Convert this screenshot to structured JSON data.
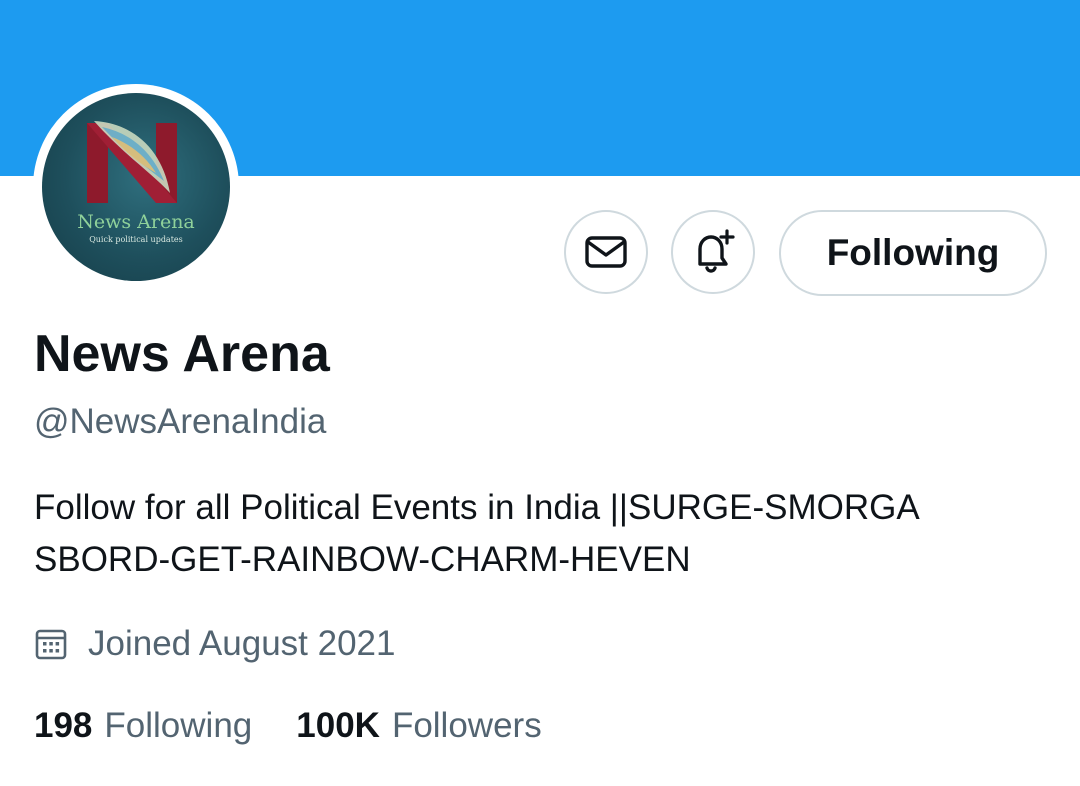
{
  "colors": {
    "banner": "#1d9bf0",
    "text_primary": "#0f1419",
    "text_secondary": "#536471",
    "button_border": "#cfd9de"
  },
  "avatar": {
    "logo_title": "News Arena",
    "logo_subtitle": "Quick political updates"
  },
  "actions": {
    "message_icon": "envelope-icon",
    "notify_icon": "bell-plus-icon",
    "following_label": "Following"
  },
  "profile": {
    "name": "News Arena",
    "handle": "@NewsArenaIndia",
    "bio_line1": "Follow for all Political Events in India ||SURGE-SMORGA",
    "bio_line2": "SBORD-GET-RAINBOW-CHARM-HEVEN",
    "joined_icon": "calendar-icon",
    "joined": "Joined August 2021"
  },
  "stats": {
    "following_count": "198",
    "following_label": "Following",
    "followers_count": "100K",
    "followers_label": "Followers"
  }
}
